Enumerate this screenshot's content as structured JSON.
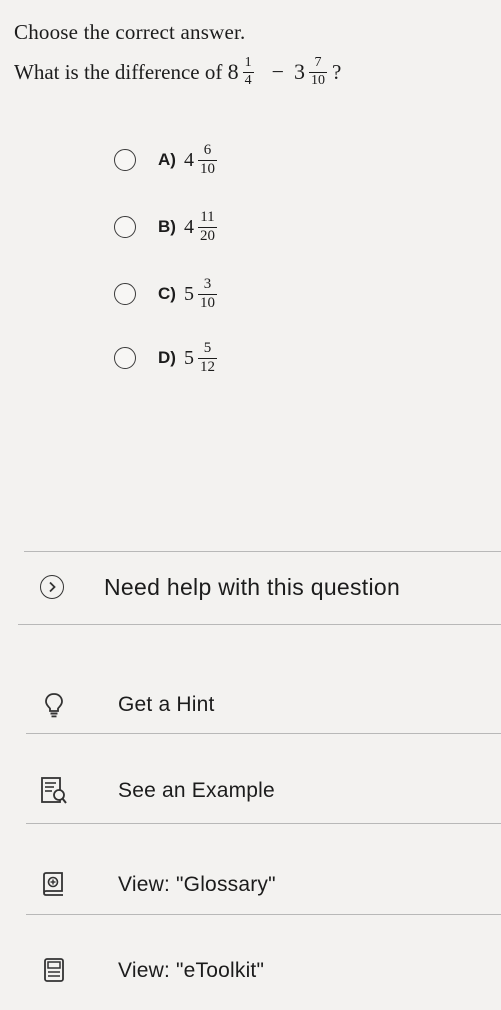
{
  "instruction": "Choose the correct answer.",
  "question": {
    "prefix": "What is the difference of",
    "first": {
      "whole": "8",
      "num": "1",
      "den": "4"
    },
    "operator": "−",
    "second": {
      "whole": "3",
      "num": "7",
      "den": "10"
    },
    "suffix": "?"
  },
  "options": [
    {
      "letter": "A)",
      "whole": "4",
      "num": "6",
      "den": "10"
    },
    {
      "letter": "B)",
      "whole": "4",
      "num": "11",
      "den": "20"
    },
    {
      "letter": "C)",
      "whole": "5",
      "num": "3",
      "den": "10"
    },
    {
      "letter": "D)",
      "whole": "5",
      "num": "5",
      "den": "12"
    }
  ],
  "help": {
    "title": "Need help with this question",
    "tools": [
      {
        "label": "Get a Hint",
        "icon": "lightbulb-icon"
      },
      {
        "label": "See an Example",
        "icon": "example-icon"
      },
      {
        "label": "View: \"Glossary\"",
        "icon": "glossary-icon"
      },
      {
        "label": "View: \"eToolkit\"",
        "icon": "etoolkit-icon"
      }
    ]
  }
}
